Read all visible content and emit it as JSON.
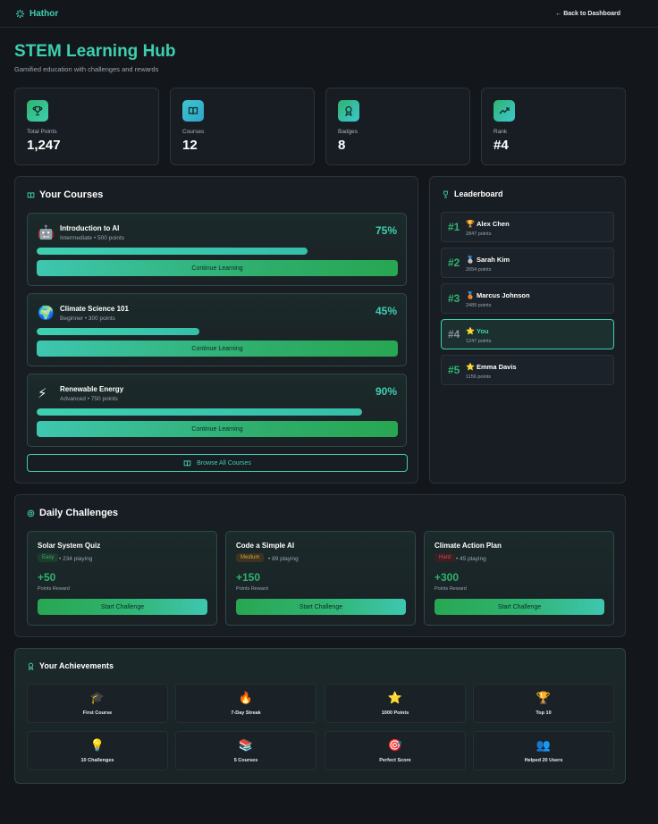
{
  "app": {
    "brand": "Hathor",
    "back_link": "← Back to Dashboard"
  },
  "page": {
    "title": "STEM Learning Hub",
    "subtitle": "Gamified education with challenges and rewards"
  },
  "stats": [
    {
      "label": "Total Points",
      "value": "1,247",
      "icon": "trophy-icon",
      "color": "#2fb36f"
    },
    {
      "label": "Courses",
      "value": "12",
      "icon": "book-icon",
      "color": "#3ec7d0"
    },
    {
      "label": "Badges",
      "value": "8",
      "icon": "award-icon",
      "color": "#2fb3a0"
    },
    {
      "label": "Rank",
      "value": "#4",
      "icon": "trending-up-icon",
      "color": "#2fb36f"
    }
  ],
  "courses_section": {
    "title": "Your Courses",
    "items": [
      {
        "name": "Introduction to AI",
        "meta": "Intermediate • 500 points",
        "progress": 75,
        "progress_label": "75%",
        "emoji": "🤖",
        "button": "Continue Learning"
      },
      {
        "name": "Climate Science 101",
        "meta": "Beginner • 300 points",
        "progress": 45,
        "progress_label": "45%",
        "emoji": "🌍",
        "button": "Continue Learning"
      },
      {
        "name": "Renewable Energy",
        "meta": "Advanced • 750 points",
        "progress": 90,
        "progress_label": "90%",
        "emoji": "⚡",
        "button": "Continue Learning"
      }
    ],
    "browse_label": "Browse All Courses"
  },
  "leaderboard": {
    "title": "Leaderboard",
    "rows": [
      {
        "rank": "#1",
        "medal": "🏆",
        "name": "Alex Chen",
        "points": "2847 points",
        "is_you": false
      },
      {
        "rank": "#2",
        "medal": "🥈",
        "name": "Sarah Kim",
        "points": "2654 points",
        "is_you": false
      },
      {
        "rank": "#3",
        "medal": "🥉",
        "name": "Marcus Johnson",
        "points": "2489 points",
        "is_you": false
      },
      {
        "rank": "#4",
        "medal": "⭐",
        "name": "You",
        "points": "1247 points",
        "is_you": true
      },
      {
        "rank": "#5",
        "medal": "⭐",
        "name": "Emma Davis",
        "points": "1156 points",
        "is_you": false
      }
    ]
  },
  "challenges": {
    "title": "Daily Challenges",
    "items": [
      {
        "name": "Solar System Quiz",
        "difficulty": "Easy",
        "difficulty_color": "#2fb36f",
        "playing": "• 234 playing",
        "reward": "+50",
        "reward_label": "Points Reward",
        "button": "Start Challenge"
      },
      {
        "name": "Code a Simple AI",
        "difficulty": "Medium",
        "difficulty_color": "#d9a23a",
        "playing": "• 89 playing",
        "reward": "+150",
        "reward_label": "Points Reward",
        "button": "Start Challenge"
      },
      {
        "name": "Climate Action Plan",
        "difficulty": "Hard",
        "difficulty_color": "#d94a4a",
        "playing": "• 45 playing",
        "reward": "+300",
        "reward_label": "Points Reward",
        "button": "Start Challenge"
      }
    ]
  },
  "achievements": {
    "title": "Your Achievements",
    "items": [
      {
        "icon": "🎓",
        "label": "First Course"
      },
      {
        "icon": "🔥",
        "label": "7-Day Streak"
      },
      {
        "icon": "⭐",
        "label": "1000 Points"
      },
      {
        "icon": "🏆",
        "label": "Top 10"
      },
      {
        "icon": "💡",
        "label": "10 Challenges"
      },
      {
        "icon": "📚",
        "label": "5 Courses"
      },
      {
        "icon": "🎯",
        "label": "Perfect Score"
      },
      {
        "icon": "👥",
        "label": "Helped 20 Users"
      }
    ]
  }
}
